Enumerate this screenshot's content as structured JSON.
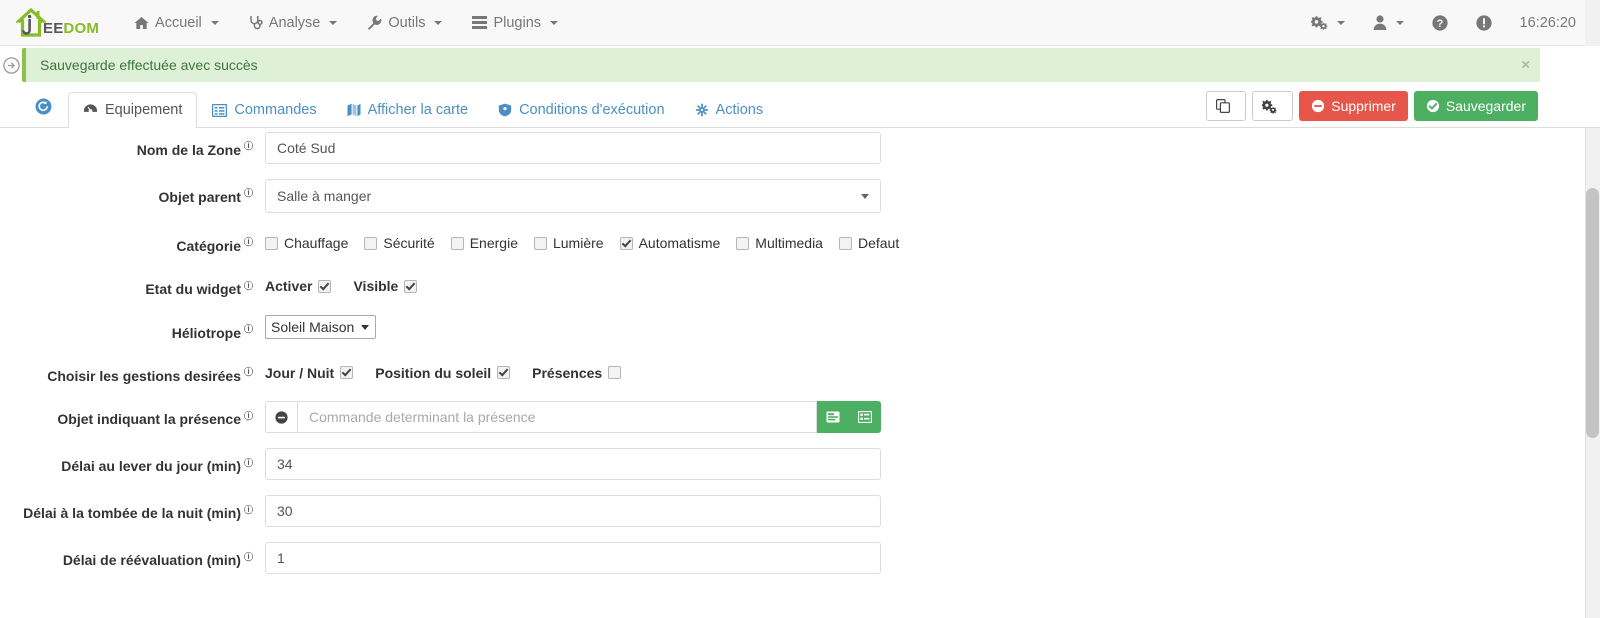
{
  "navbar": {
    "brand": {
      "text_ee": "EE",
      "text_dom": "DOM",
      "icon": "jeedom-house-logo"
    },
    "items": [
      {
        "label": "Accueil",
        "icon": "home-icon",
        "caret": true
      },
      {
        "label": "Analyse",
        "icon": "stethoscope-icon",
        "caret": true
      },
      {
        "label": "Outils",
        "icon": "wrench-icon",
        "caret": true
      },
      {
        "label": "Plugins",
        "icon": "server-list-icon",
        "caret": true
      }
    ],
    "right": [
      {
        "label": "",
        "icon": "gears-icon",
        "caret": true
      },
      {
        "label": "",
        "icon": "user-icon",
        "caret": true
      },
      {
        "label": "",
        "icon": "help-circle-icon",
        "caret": false
      },
      {
        "label": "",
        "icon": "info-circle-icon",
        "caret": false
      }
    ],
    "clock": "16:26:20"
  },
  "alert": {
    "message": "Sauvegarde effectuée avec succès",
    "close_label": "×",
    "sidebar_toggle_icon": "circle-arrow-right-icon",
    "bg_color": "#dff0d8",
    "text_color": "#3c763d",
    "border_color": "#8bc34a"
  },
  "tabbar": {
    "back_icon": "arrow-circle-left-icon",
    "tabs": [
      {
        "label": "Equipement",
        "icon": "dashboard-icon",
        "active": true
      },
      {
        "label": "Commandes",
        "icon": "list-alt-icon",
        "active": false
      },
      {
        "label": "Afficher la carte",
        "icon": "map-icon",
        "active": false
      },
      {
        "label": "Conditions d'exécution",
        "icon": "shield-icon",
        "active": false
      },
      {
        "label": "Actions",
        "icon": "asterisk-icon",
        "active": false
      }
    ],
    "actions": {
      "copy_label": "",
      "copy_icon": "copy-icon",
      "config_label": "",
      "config_icon": "gears-icon",
      "delete_label": "Supprimer",
      "delete_icon": "minus-circle-icon",
      "save_label": "Sauvegarder",
      "save_icon": "check-circle-icon",
      "delete_color": "#e7564a",
      "save_color": "#4caf62"
    }
  },
  "form": {
    "nom_zone": {
      "label": "Nom de la Zone",
      "value": "Coté Sud",
      "help": "?"
    },
    "objet_parent": {
      "label": "Objet parent",
      "value": "Salle à manger",
      "help": "?"
    },
    "categorie": {
      "label": "Catégorie",
      "help": "?",
      "options": [
        {
          "label": "Chauffage",
          "checked": false
        },
        {
          "label": "Sécurité",
          "checked": false
        },
        {
          "label": "Energie",
          "checked": false
        },
        {
          "label": "Lumière",
          "checked": false
        },
        {
          "label": "Automatisme",
          "checked": true
        },
        {
          "label": "Multimedia",
          "checked": false
        },
        {
          "label": "Defaut",
          "checked": false
        }
      ]
    },
    "etat_widget": {
      "label": "Etat du widget",
      "help": "?",
      "options": [
        {
          "label": "Activer",
          "checked": true
        },
        {
          "label": "Visible",
          "checked": true
        }
      ]
    },
    "heliotrope": {
      "label": "Héliotrope",
      "value": "Soleil Maison",
      "help": "?"
    },
    "gestions": {
      "label": "Choisir les gestions desirées",
      "help": "?",
      "options": [
        {
          "label": "Jour / Nuit",
          "checked": true
        },
        {
          "label": "Position du soleil",
          "checked": true
        },
        {
          "label": "Présences",
          "checked": false
        }
      ]
    },
    "objet_presence": {
      "label": "Objet indiquant la présence",
      "help": "?",
      "placeholder": "Commande determinant la présence",
      "value": "",
      "addon_icon": "minus-circle-icon",
      "btn1_icon": "list-rows-icon",
      "btn2_icon": "list-detail-icon"
    },
    "delai_lever": {
      "label": "Délai au lever du jour (min)",
      "value": "34",
      "help": "?"
    },
    "delai_nuit": {
      "label": "Délai à la tombée de la nuit (min)",
      "value": "30",
      "help": "?"
    },
    "delai_reeval": {
      "label": "Délai de réévaluation (min)",
      "value": "1",
      "help": "?"
    }
  }
}
